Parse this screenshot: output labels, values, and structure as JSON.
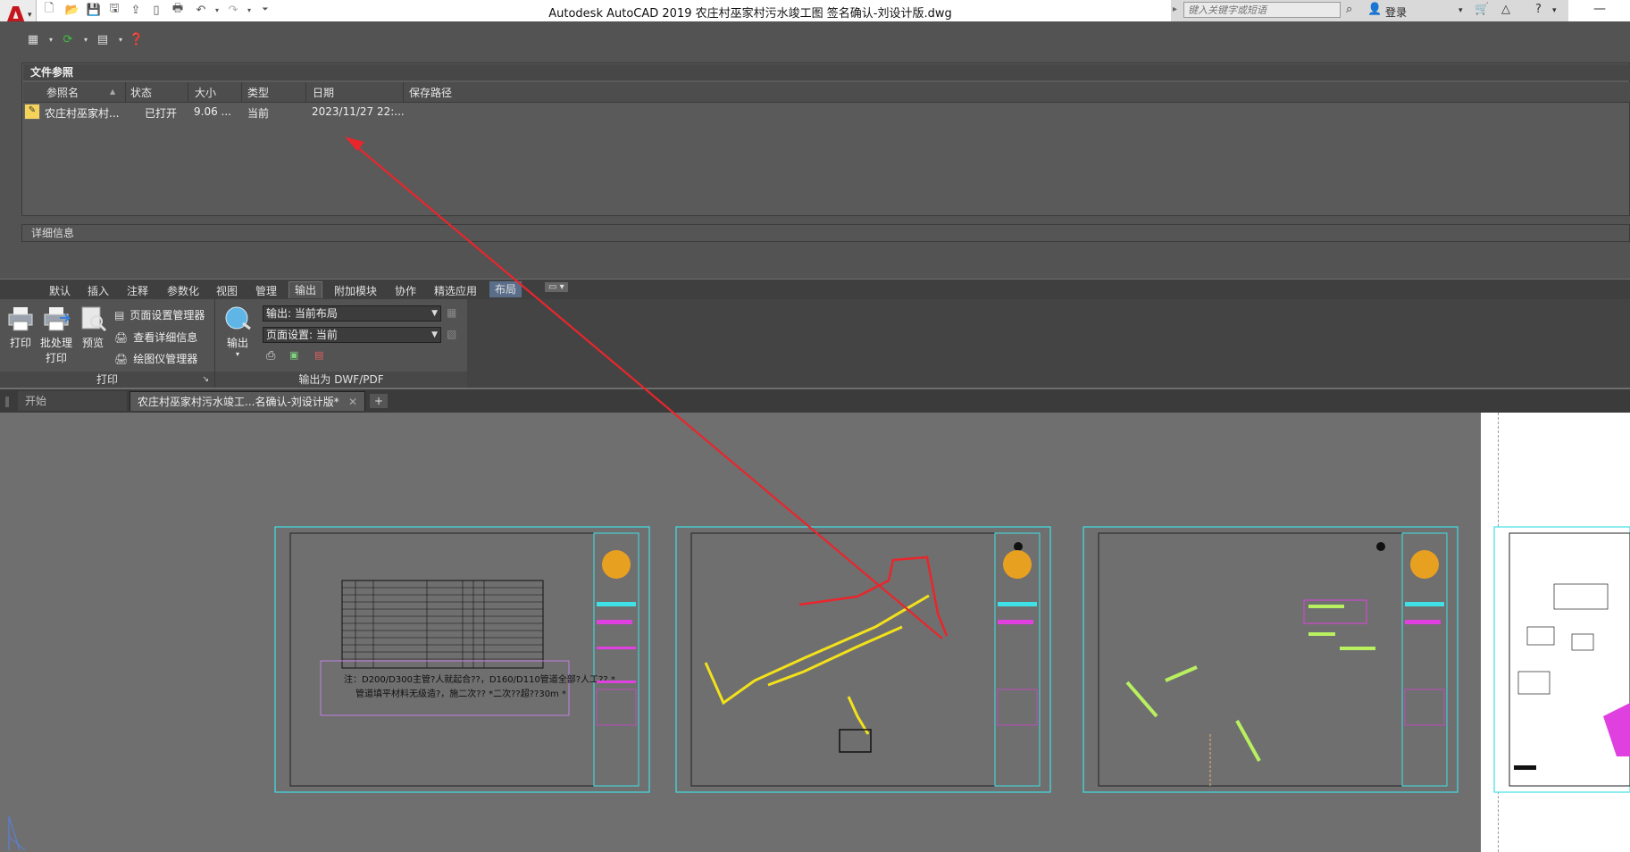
{
  "titlebar": {
    "title": "Autodesk AutoCAD 2019    农庄村巫家村污水竣工图 签名确认-刘设计版.dwg",
    "search_placeholder": "键入关键字或短语",
    "login_label": "登录"
  },
  "xref": {
    "palette_title": "文件参照",
    "columns": [
      "参照名",
      "状态",
      "大小",
      "类型",
      "日期",
      "保存路径"
    ],
    "rows": [
      {
        "name": "农庄村巫家村...",
        "status": "已打开",
        "size": "9.06 ...",
        "type": "当前",
        "date": "2023/11/27 22:...",
        "path": ""
      }
    ],
    "details_label": "详细信息"
  },
  "ribbon": {
    "tabs": [
      "默认",
      "插入",
      "注释",
      "参数化",
      "视图",
      "管理",
      "输出",
      "附加模块",
      "协作",
      "精选应用",
      "布局"
    ],
    "active_tab": "输出",
    "print_panel": {
      "label": "打印",
      "print": "打印",
      "batch_print_1": "批处理",
      "batch_print_2": "打印",
      "preview": "预览",
      "page_setup_manager": "页面设置管理器",
      "view_details": "查看详细信息",
      "plotter_manager": "绘图仪管理器"
    },
    "export_panel": {
      "label": "输出为 DWF/PDF",
      "export": "输出",
      "export_combo": "输出: 当前布局",
      "page_setup_combo": "页面设置: 当前"
    }
  },
  "file_tabs": {
    "start": "开始",
    "drawing": "农庄村巫家村污水竣工...名确认-刘设计版*"
  },
  "drawing": {
    "sheet1_note_line1": "注：D200/D300主管?人就起合??，D160/D110管道全部?人工?? *",
    "sheet1_note_line2": "管道填平材料无级造?，施二次?? *二次??超??30m *"
  },
  "colors": {
    "accent_red": "#e8262c",
    "cyan": "#3fe0e6",
    "magenta": "#e040e0",
    "yellow": "#f3e11a"
  }
}
